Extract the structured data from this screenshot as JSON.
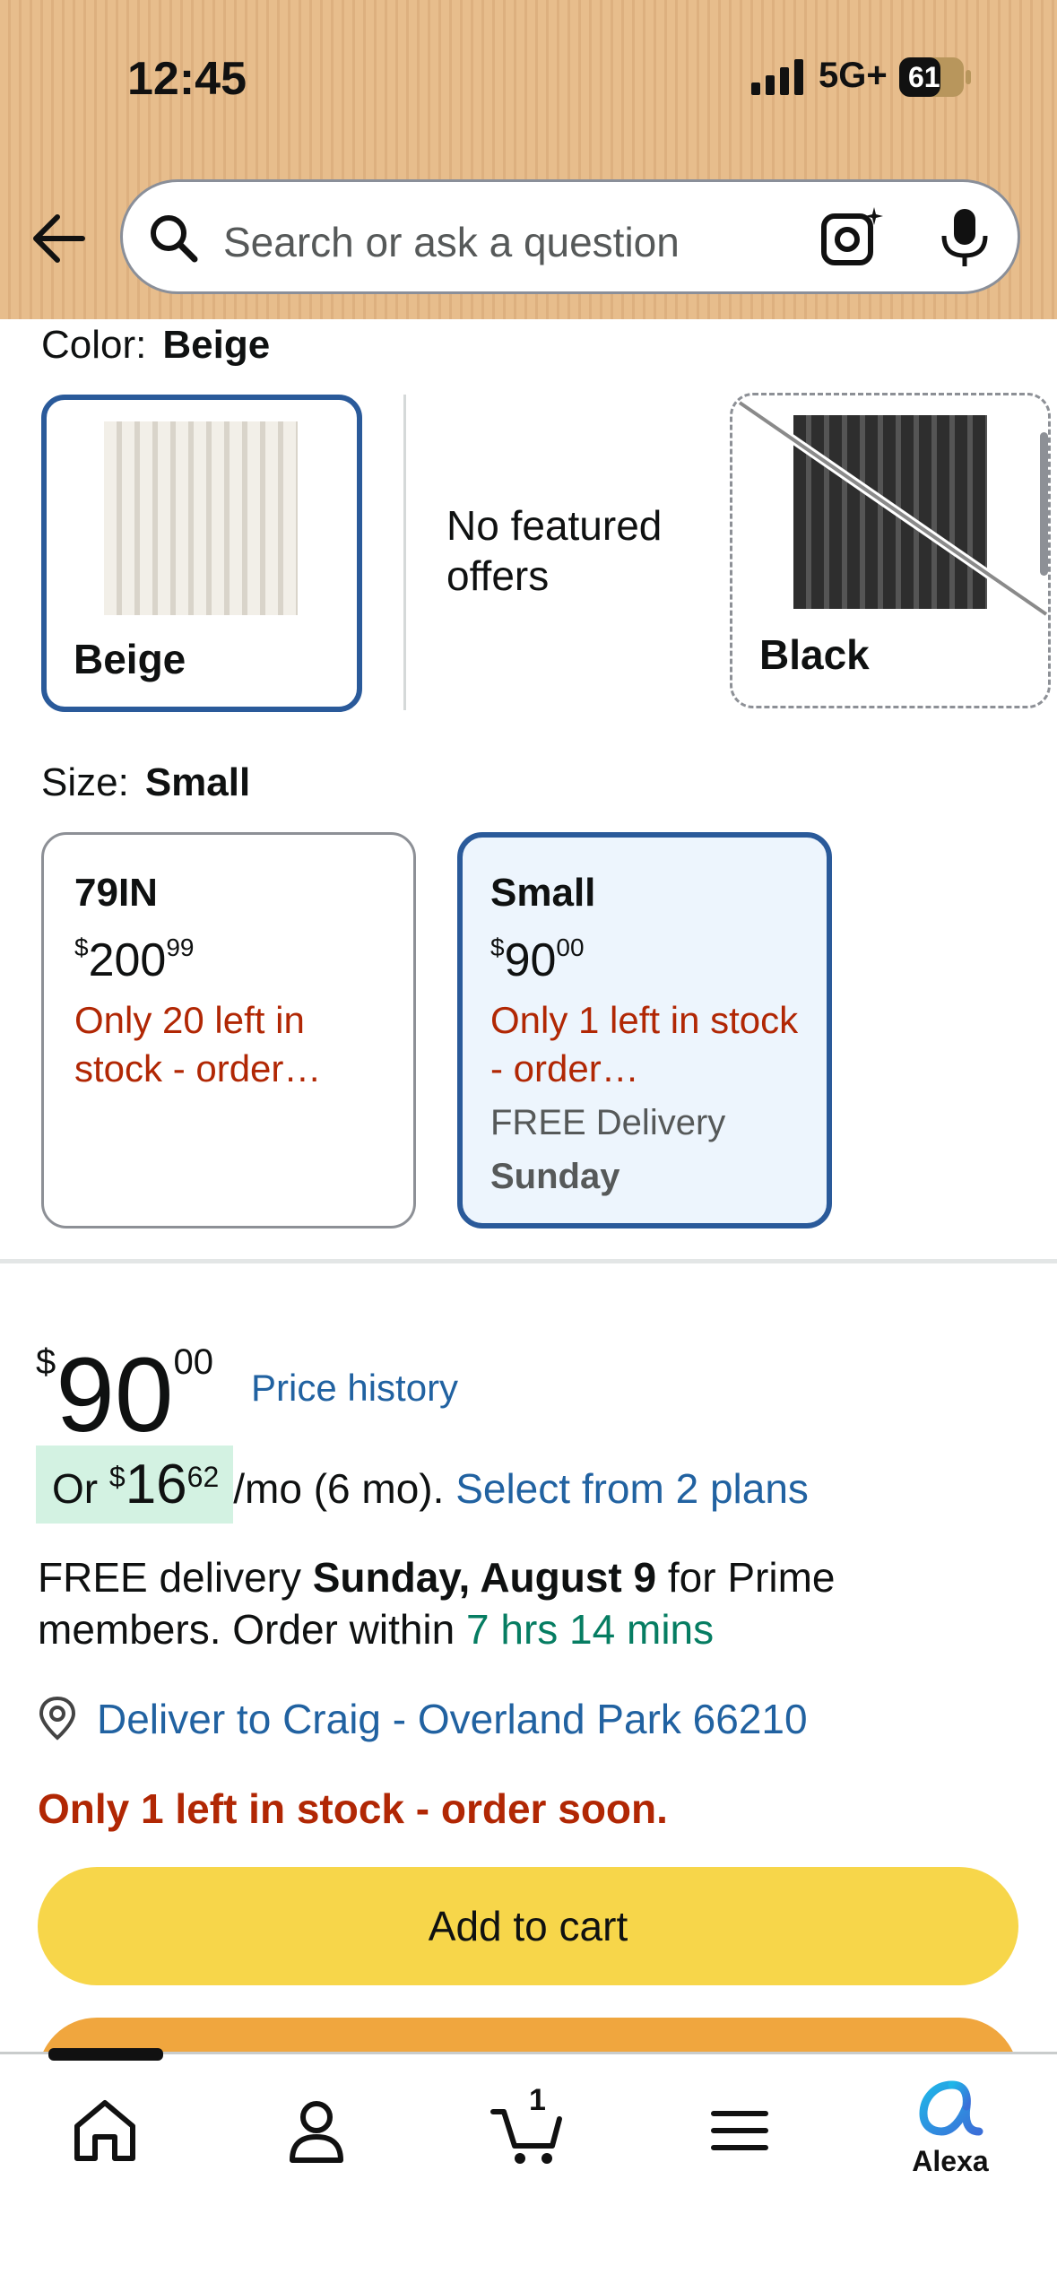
{
  "status_bar": {
    "time": "12:45",
    "network": "5G+",
    "battery": "61"
  },
  "search": {
    "placeholder": "Search or ask a question"
  },
  "color": {
    "label": "Color:",
    "selected": "Beige",
    "options": [
      {
        "name": "Beige",
        "selected": true
      },
      {
        "name": "Black",
        "selected": false,
        "unavailable": true
      }
    ],
    "no_offers_text": "No featured offers"
  },
  "size": {
    "label": "Size:",
    "selected": "Small",
    "options": [
      {
        "name": "79IN",
        "price_dollars": "200",
        "price_cents": "99",
        "stock": "Only 20 left in stock - order…"
      },
      {
        "name": "Small",
        "price_dollars": "90",
        "price_cents": "00",
        "stock": "Only 1 left in stock - order…",
        "delivery": "FREE Delivery",
        "delivery_day": "Sunday"
      }
    ]
  },
  "buybox": {
    "currency": "$",
    "price_dollars": "90",
    "price_cents": "00",
    "price_history_link": "Price history",
    "installment": {
      "prefix": "Or ",
      "currency": "$",
      "amount_dollars": "16",
      "amount_cents": "62",
      "suffix": "/mo (6 mo). ",
      "link": "Select from 2 plans"
    },
    "delivery": {
      "part1": "FREE delivery ",
      "date": "Sunday, August 9",
      "part2": " for Prime members. Order within ",
      "countdown": "7 hrs 14 mins"
    },
    "deliver_to": "Deliver to Craig - Overland Park 66210",
    "stock_warning": "Only 1 left in stock - order soon.",
    "add_to_cart": "Add to cart"
  },
  "bottom_nav": {
    "cart_count": "1",
    "alexa_label": "Alexa"
  },
  "colors": {
    "header_bg": "#e7bd8c",
    "link": "#2162a1",
    "stock_red": "#b12704",
    "add_to_cart": "#f7d64a",
    "buy_now": "#f0a63e",
    "selected_border": "#2a5a9a",
    "countdown_green": "#067d62"
  }
}
